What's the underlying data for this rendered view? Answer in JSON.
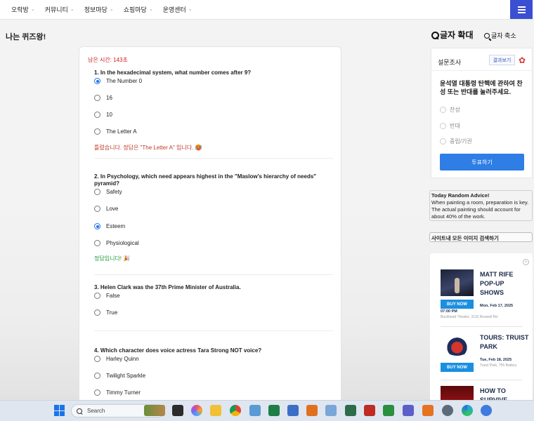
{
  "nav": {
    "items": [
      {
        "label": "오락방"
      },
      {
        "label": "커뮤니티"
      },
      {
        "label": "정보마당"
      },
      {
        "label": "쇼핑마당"
      },
      {
        "label": "운영센터"
      }
    ]
  },
  "page": {
    "title": "나는 퀴즈왕!",
    "font_up": "글자 확대",
    "font_down": "글자 축소"
  },
  "quiz": {
    "timer": "남은 시간: 143초",
    "questions": [
      {
        "text": "1. In the hexadecimal system, what number comes after 9?",
        "options": [
          "The Number 0",
          "16",
          "10",
          "The Letter A"
        ],
        "selected": 0,
        "feedback": "틀렸습니다. 정답은 \"The Letter A\" 입니다. 🥵"
      },
      {
        "text": "2. In Psychology, which need appears highest in the \"Maslow's hierarchy of needs\" pyramid?",
        "options": [
          "Safety",
          "Love",
          "Esteem",
          "Physiological"
        ],
        "selected": 2,
        "feedback": "정답입니다! 🎉"
      },
      {
        "text": "3. Helen Clark was the 37th Prime Minister of Australia.",
        "options": [
          "False",
          "True"
        ],
        "selected": null,
        "feedback": ""
      },
      {
        "text": "4. Which character does voice actress Tara Strong NOT voice?",
        "options": [
          "Harley Quinn",
          "Twilight Sparkle",
          "Timmy Turner"
        ],
        "selected": null,
        "feedback": ""
      }
    ]
  },
  "poll": {
    "title": "설문조사",
    "result_button": "결과보기",
    "question": "윤석열 대통령 탄핵에 관하여 찬성 또는 반대를 눌러주세요.",
    "options": [
      "찬성",
      "반대",
      "중립/기권"
    ],
    "vote_button": "투표하기"
  },
  "advice": {
    "heading": "Today Random Advice!",
    "text": "When painting a room, preparation is key. The actual painting should account for about 40% of the work."
  },
  "image_search": "사이트내 모든 이미지 검색하기",
  "ad": {
    "events": [
      {
        "title": "MATT RIFE POP-UP SHOWS",
        "buy": "BUY NOW",
        "date": "Mon, Feb 17, 2025",
        "time": "07:00 PM",
        "venue": "Buckhead Theatre, 3110 Roswell Rd"
      },
      {
        "title": "TOURS: TRUIST PARK",
        "buy": "BUY NOW",
        "date": "Tue, Feb 18, 2025",
        "venue": "Truist Park, 755 Battery"
      },
      {
        "title": "HOW TO SURVIVE"
      }
    ]
  },
  "taskbar": {
    "search_placeholder": "Search"
  }
}
